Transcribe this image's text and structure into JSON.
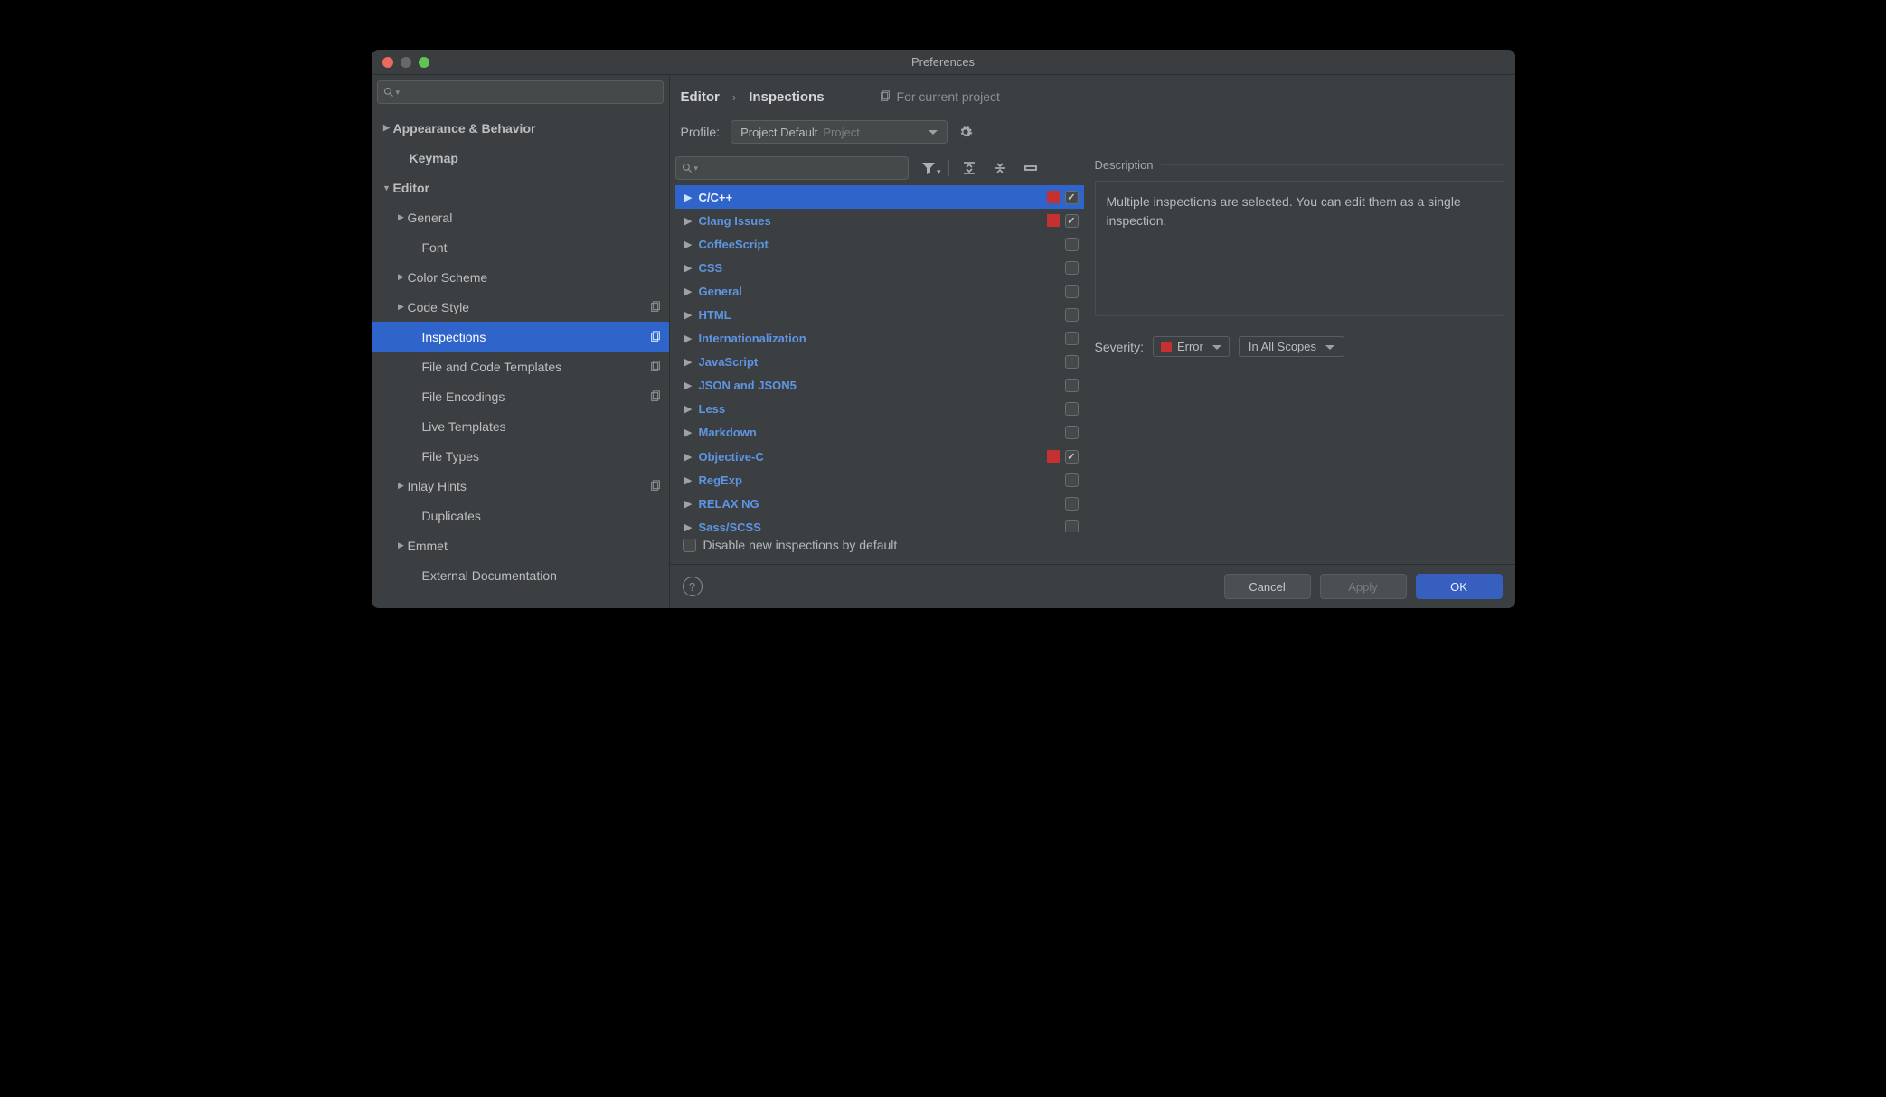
{
  "window": {
    "title": "Preferences"
  },
  "sidebar": {
    "search_placeholder": "",
    "items": [
      {
        "label": "Appearance & Behavior",
        "arrow": "right",
        "bold": true
      },
      {
        "label": "Keymap",
        "arrow": "",
        "bold": true,
        "indent": 1
      },
      {
        "label": "Editor",
        "arrow": "down",
        "bold": true
      },
      {
        "label": "General",
        "arrow": "right",
        "indent": 2
      },
      {
        "label": "Font",
        "arrow": "",
        "indent": 2
      },
      {
        "label": "Color Scheme",
        "arrow": "right",
        "indent": 2
      },
      {
        "label": "Code Style",
        "arrow": "right",
        "indent": 2,
        "dup": true
      },
      {
        "label": "Inspections",
        "arrow": "",
        "indent": 2,
        "dup": true,
        "selected": true
      },
      {
        "label": "File and Code Templates",
        "arrow": "",
        "indent": 2,
        "dup": true
      },
      {
        "label": "File Encodings",
        "arrow": "",
        "indent": 2,
        "dup": true
      },
      {
        "label": "Live Templates",
        "arrow": "",
        "indent": 2
      },
      {
        "label": "File Types",
        "arrow": "",
        "indent": 2
      },
      {
        "label": "Inlay Hints",
        "arrow": "right",
        "indent": 2,
        "dup": true
      },
      {
        "label": "Duplicates",
        "arrow": "",
        "indent": 2
      },
      {
        "label": "Emmet",
        "arrow": "right",
        "indent": 2
      },
      {
        "label": "External Documentation",
        "arrow": "",
        "indent": 2
      }
    ]
  },
  "breadcrumb": {
    "a": "Editor",
    "b": "Inspections",
    "meta": "For current project"
  },
  "profile": {
    "label": "Profile:",
    "value": "Project Default",
    "suffix": "Project"
  },
  "inspections": [
    {
      "name": "C/C++",
      "red": true,
      "checked": true,
      "selected": true
    },
    {
      "name": "Clang Issues",
      "red": true,
      "checked": true
    },
    {
      "name": "CoffeeScript"
    },
    {
      "name": "CSS"
    },
    {
      "name": "General"
    },
    {
      "name": "HTML"
    },
    {
      "name": "Internationalization"
    },
    {
      "name": "JavaScript"
    },
    {
      "name": "JSON and JSON5"
    },
    {
      "name": "Less"
    },
    {
      "name": "Markdown"
    },
    {
      "name": "Objective-C",
      "red": true,
      "checked": true
    },
    {
      "name": "RegExp"
    },
    {
      "name": "RELAX NG"
    },
    {
      "name": "Sass/SCSS"
    }
  ],
  "disable_label": "Disable new inspections by default",
  "description": {
    "title": "Description",
    "text": "Multiple inspections are selected. You can edit them as a single inspection."
  },
  "severity": {
    "label": "Severity:",
    "value": "Error",
    "scope": "In All Scopes"
  },
  "footer": {
    "cancel": "Cancel",
    "apply": "Apply",
    "ok": "OK"
  }
}
